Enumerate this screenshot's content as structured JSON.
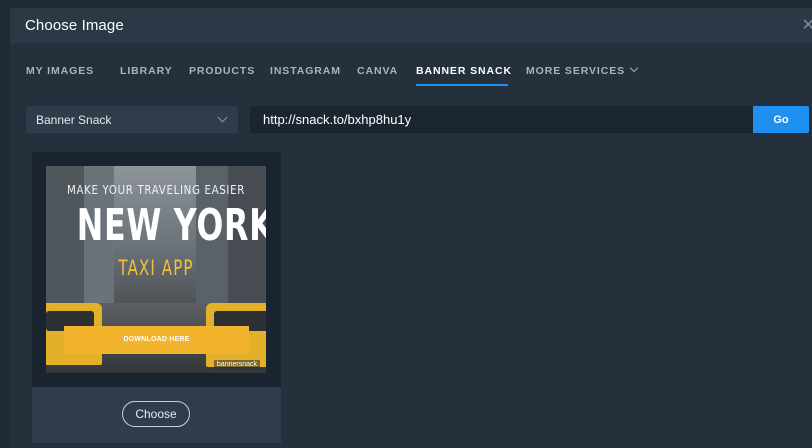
{
  "dialog": {
    "title": "Choose Image",
    "close_icon": "close-icon"
  },
  "tabs": [
    {
      "label": "MY IMAGES",
      "active": false
    },
    {
      "label": "LIBRARY",
      "active": false
    },
    {
      "label": "PRODUCTS",
      "active": false
    },
    {
      "label": "INSTAGRAM",
      "active": false
    },
    {
      "label": "CANVA",
      "active": false
    },
    {
      "label": "BANNER SNACK",
      "active": true
    },
    {
      "label": "MORE SERVICES",
      "active": false,
      "icon": "chevron-down-icon"
    }
  ],
  "source": {
    "selected": "Banner Snack"
  },
  "url": {
    "value": "http://snack.to/bxhp8hu1y",
    "go_label": "Go"
  },
  "result": {
    "banner_top_line": "MAKE YOUR TRAVELING EASIER",
    "banner_headline": "NEW YORK",
    "banner_sub": "TAXI APP",
    "banner_cta": "DOWNLOAD HERE",
    "banner_brand": "bannersnack",
    "choose_label": "Choose"
  },
  "colors": {
    "accent": "#1f8ff0",
    "background": "#24303c",
    "banner_yellow": "#f2b42c"
  }
}
